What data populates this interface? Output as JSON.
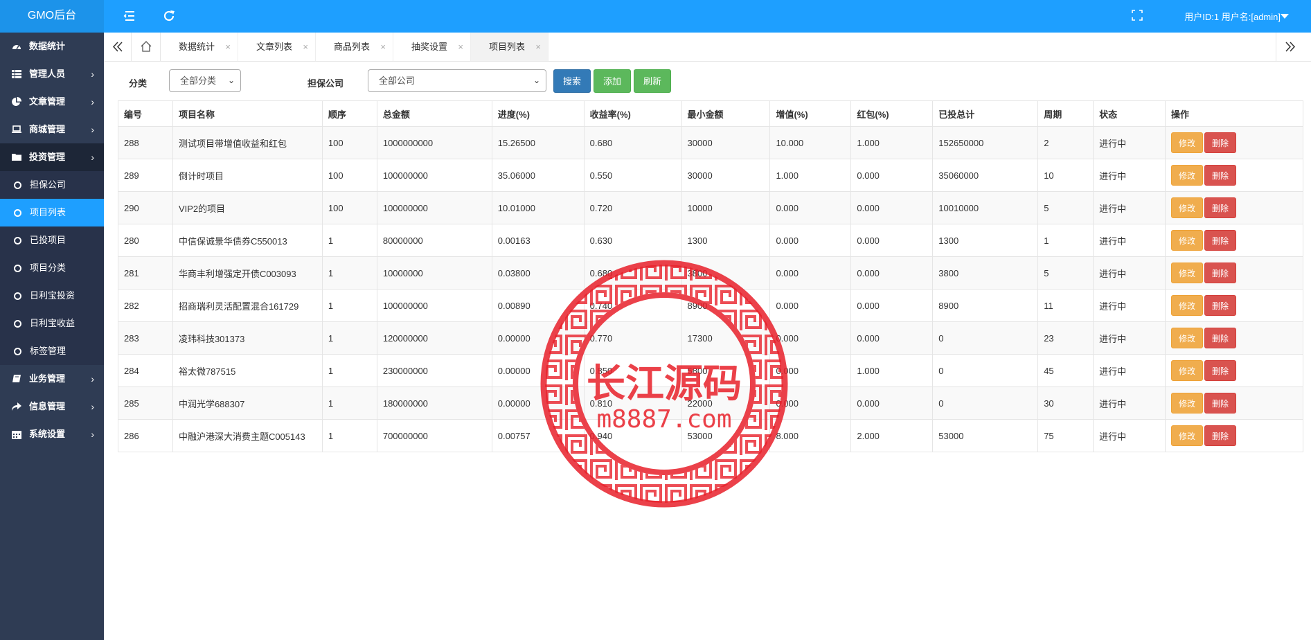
{
  "app": {
    "title": "GMO后台",
    "user_info": "用户ID:1 用户名:[admin]"
  },
  "sidebar": {
    "items": [
      {
        "label": "数据统计",
        "icon": "dashboard-icon"
      },
      {
        "label": "管理人员",
        "icon": "grid-icon"
      },
      {
        "label": "文章管理",
        "icon": "pie-chart-icon"
      },
      {
        "label": "商城管理",
        "icon": "laptop-icon"
      },
      {
        "label": "投资管理",
        "icon": "folder-icon"
      }
    ],
    "sub_items": [
      "担保公司",
      "项目列表",
      "已投项目",
      "项目分类",
      "日利宝投资",
      "日利宝收益",
      "标签管理"
    ],
    "items_after": [
      {
        "label": "业务管理",
        "icon": "book-icon"
      },
      {
        "label": "信息管理",
        "icon": "share-icon"
      },
      {
        "label": "系统设置",
        "icon": "calendar-icon"
      }
    ]
  },
  "tabs": [
    "数据统计",
    "文章列表",
    "商品列表",
    "抽奖设置",
    "项目列表"
  ],
  "filters": {
    "category_label": "分类",
    "category_value": "全部分类",
    "company_label": "担保公司",
    "company_value": "全部公司"
  },
  "buttons": {
    "search": "搜索",
    "add": "添加",
    "refresh": "刷新",
    "edit": "修改",
    "delete": "删除"
  },
  "colors": {
    "primary": "#1e9fff",
    "sidebar": "#2f3c54",
    "search": "#337ab7",
    "success": "#5cb85c",
    "warning": "#f0ad4e",
    "danger": "#d9534f",
    "stamp": "#e8202a"
  },
  "table": {
    "headers": [
      "编号",
      "项目名称",
      "顺序",
      "总金额",
      "进度(%)",
      "收益率(%)",
      "最小金额",
      "增值(%)",
      "红包(%)",
      "已投总计",
      "周期",
      "状态",
      "操作"
    ],
    "rows": [
      [
        "288",
        "测试项目带增值收益和红包",
        "100",
        "1000000000",
        "15.26500",
        "0.680",
        "30000",
        "10.000",
        "1.000",
        "152650000",
        "2",
        "进行中"
      ],
      [
        "289",
        "倒计时项目",
        "100",
        "100000000",
        "35.06000",
        "0.550",
        "30000",
        "1.000",
        "0.000",
        "35060000",
        "10",
        "进行中"
      ],
      [
        "290",
        "VIP2的项目",
        "100",
        "100000000",
        "10.01000",
        "0.720",
        "10000",
        "0.000",
        "0.000",
        "10010000",
        "5",
        "进行中"
      ],
      [
        "280",
        "中信保诚景华债券C550013",
        "1",
        "80000000",
        "0.00163",
        "0.630",
        "1300",
        "0.000",
        "0.000",
        "1300",
        "1",
        "进行中"
      ],
      [
        "281",
        "华商丰利增强定开债C003093",
        "1",
        "10000000",
        "0.03800",
        "0.680",
        "3800",
        "0.000",
        "0.000",
        "3800",
        "5",
        "进行中"
      ],
      [
        "282",
        "招商瑞利灵活配置混合161729",
        "1",
        "100000000",
        "0.00890",
        "0.740",
        "8900",
        "0.000",
        "0.000",
        "8900",
        "11",
        "进行中"
      ],
      [
        "283",
        "凌玮科技301373",
        "1",
        "120000000",
        "0.00000",
        "0.770",
        "17300",
        "0.000",
        "0.000",
        "0",
        "23",
        "进行中"
      ],
      [
        "284",
        "裕太微787515",
        "1",
        "230000000",
        "0.00000",
        "0.850",
        "5800",
        "0.000",
        "1.000",
        "0",
        "45",
        "进行中"
      ],
      [
        "285",
        "中润光学688307",
        "1",
        "180000000",
        "0.00000",
        "0.810",
        "22000",
        "0.000",
        "0.000",
        "0",
        "30",
        "进行中"
      ],
      [
        "286",
        "中融沪港深大消费主题C005143",
        "1",
        "700000000",
        "0.00757",
        "0.940",
        "53000",
        "8.000",
        "2.000",
        "53000",
        "75",
        "进行中"
      ]
    ]
  },
  "watermark": {
    "line1": "长江源码",
    "line2": "m8887.com"
  }
}
